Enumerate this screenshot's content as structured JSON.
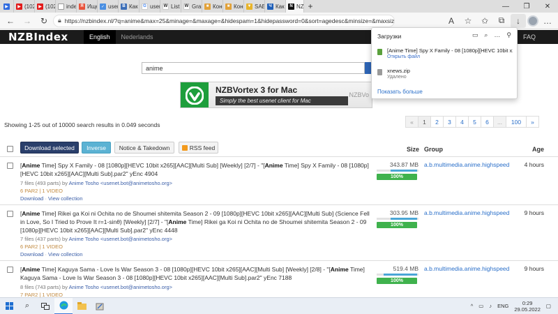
{
  "browser": {
    "tabs": [
      {
        "label": "",
        "color": "#2f6be0",
        "glyph": "▶"
      },
      {
        "label": "(102) S",
        "color": "#e21b1b",
        "glyph": "▶"
      },
      {
        "label": "(102) T",
        "color": "#e21b1b",
        "glyph": "▶"
      },
      {
        "label": "index",
        "color": "#999999",
        "glyph": ""
      },
      {
        "label": "Ищем",
        "color": "#e8533b",
        "glyph": "Я"
      },
      {
        "label": "usenet",
        "color": "#4a8fe2",
        "glyph": "✓"
      },
      {
        "label": "Как по",
        "color": "#3d6fb8",
        "glyph": "В"
      },
      {
        "label": "usenet",
        "color": "#ffffff",
        "glyph": "G"
      },
      {
        "label": "List of",
        "color": "#ffffff",
        "glyph": "W"
      },
      {
        "label": "GrabIt",
        "color": "#ffffff",
        "glyph": "W"
      },
      {
        "label": "Консо",
        "color": "#e2a23a",
        "glyph": "■"
      },
      {
        "label": "Консо",
        "color": "#e2a23a",
        "glyph": "■"
      },
      {
        "label": "SABnz",
        "color": "#e8b42a",
        "glyph": "▼"
      },
      {
        "label": "Как по",
        "color": "#1f5fb8",
        "glyph": "Ч"
      },
      {
        "label": "NZ",
        "color": "#111111",
        "glyph": "N"
      }
    ],
    "url": "https://nzbindex.nl/?q=anime&max=25&minage=&maxage=&hidespam=1&hidepassword=0&sort=agedesc&minsize=&maxsize=&co..."
  },
  "site": {
    "logo": "NZBIndex",
    "nav": {
      "english": "English",
      "nederlands": "Nederlands",
      "faq": "FAQ"
    }
  },
  "search": {
    "value": "anime"
  },
  "banner": {
    "title": "NZBVortex 3 for Mac",
    "subtitle": "Simply the best usenet client for Mac",
    "brand": "NZBVo"
  },
  "results_info": "Showing 1-25 out of 10000 search results in 0.049 seconds",
  "pagination": [
    "«",
    "1",
    "2",
    "3",
    "4",
    "5",
    "6",
    "...",
    "100",
    "»"
  ],
  "actions": {
    "download_selected": "Download selected",
    "inverse": "Inverse",
    "notice": "Notice & Takedown",
    "rss": "RSS feed"
  },
  "columns": {
    "size": "Size",
    "group": "Group",
    "age": "Age"
  },
  "results": [
    {
      "title_before": "[",
      "title_bold": "Anime",
      "title_after": " Time] Spy X Family - 08 [1080p][HEVC 10bit x265][AAC][Multi Sub] [Weekly] [2/7] - \"[",
      "title_bold2": "Anime",
      "title_end": " Time] Spy X Family - 08 [1080p][HEVC 10bit x265][AAC][Multi Sub].par2\" yEnc 4904",
      "meta": "7 files (493 parts) by",
      "poster": "Anime Tosho <usenet.bot@animetosho.org>",
      "par": "6 PAR2 | 1 VIDEO",
      "download": "Download",
      "view": "View collection",
      "size": "343.87 MB",
      "complete": "100%",
      "group": "a.b.multimedia.anime.highspeed",
      "age": "4 hours"
    },
    {
      "title_before": "[",
      "title_bold": "Anime",
      "title_after": " Time] Rikei ga Koi ni Ochita no de Shoumei shitemita Season 2 - 09 [1080p][HEVC 10bit x265][AAC][Multi Sub] (Science Fell in Love, So I Tried to Prove It r=1-sinθ) [Weekly] [2/7] - \"[",
      "title_bold2": "Anime",
      "title_end": " Time] Rikei ga Koi ni Ochita no de Shoumei shitemita Season 2 - 09 [1080p][HEVC 10bit x265][AAC][Multi Sub].par2\" yEnc 4448",
      "meta": "7 files (437 parts) by",
      "poster": "Anime Tosho <usenet.bot@animetosho.org>",
      "par": "6 PAR2 | 1 VIDEO",
      "download": "Download",
      "view": "View collection",
      "size": "303.95 MB",
      "complete": "100%",
      "group": "a.b.multimedia.anime.highspeed",
      "age": "9 hours"
    },
    {
      "title_before": "[",
      "title_bold": "Anime",
      "title_after": " Time] Kaguya Sama - Love Is War Season 3 - 08 [1080p][HEVC 10bit x265][AAC][Multi Sub] [Weekly] [2/8] - \"[",
      "title_bold2": "Anime",
      "title_end": " Time] Kaguya Sama - Love Is War Season 3 - 08 [1080p][HEVC 10bit x265][AAC][Multi Sub].par2\" yEnc 7188",
      "meta": "8 files (743 parts) by",
      "poster": "Anime Tosho <usenet.bot@animetosho.org>",
      "par": "7 PAR2 | 1 VIDEO",
      "download": "",
      "view": "",
      "size": "519.4 MB",
      "complete": "100%",
      "group": "a.b.multimedia.anime.highspeed",
      "age": "9 hours"
    }
  ],
  "downloads": {
    "title": "Загрузки",
    "items": [
      {
        "name": "[Anime Time] Spy X Family - 08 [1080p][HEVC 10bit x26...",
        "status": "Открыть файл",
        "color": "#5aa03c"
      },
      {
        "name": "xnews.zip",
        "status": "Удалено",
        "color": "#9a9a9a"
      }
    ],
    "more": "Показать больше"
  },
  "taskbar": {
    "lang": "ENG",
    "time": "0:29",
    "date": "29.05.2022"
  }
}
